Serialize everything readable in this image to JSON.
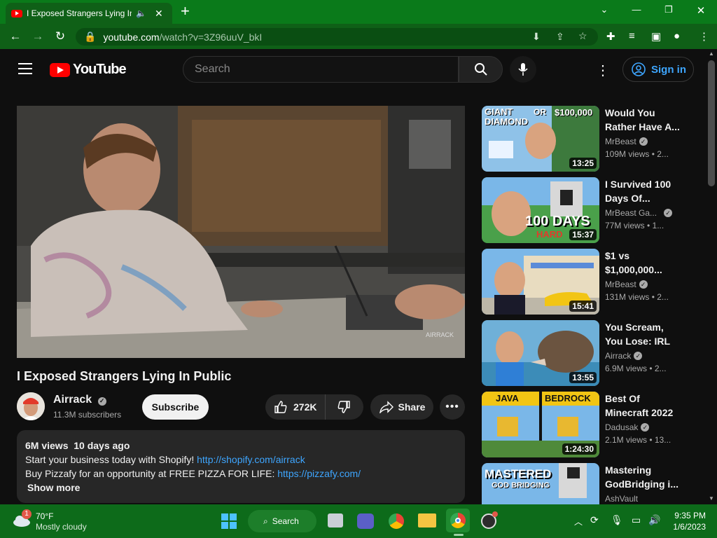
{
  "browser": {
    "tab_title": "I Exposed Strangers Lying In Public",
    "url_host": "youtube.com",
    "url_path": "/watch?v=3Z96uuV_bkI",
    "new_tab": "+"
  },
  "header": {
    "logo_text": "YouTube",
    "search_placeholder": "Search",
    "signin_label": "Sign in"
  },
  "video": {
    "title": "I Exposed Strangers Lying In Public",
    "channel": "Airrack",
    "subscribers": "11.3M subscribers",
    "subscribe_label": "Subscribe",
    "likes": "272K",
    "share_label": "Share",
    "watermark": "AIRRACK"
  },
  "description": {
    "stats": "6M views  10 days ago",
    "line1_text": "Start your business today with Shopify! ",
    "line1_link": "http://shopify.com/airrack",
    "line2_text": "Buy Pizzafy for an opportunity at FREE PIZZA FOR LIFE: ",
    "line2_link": "https://pizzafy.com/",
    "show_more": "Show more"
  },
  "recommendations": [
    {
      "title": "Would You Rather Have A...",
      "channel": "MrBeast",
      "meta": "109M views  • 2...",
      "duration": "13:25",
      "thumb_text": [
        "GIANT DIAMOND",
        "OR",
        "$100,000"
      ]
    },
    {
      "title": "I Survived 100 Days Of...",
      "channel": "MrBeast Ga...",
      "meta": "77M views  • 1...",
      "duration": "15:37",
      "thumb_text": [
        "100 DAYS",
        "HARD"
      ]
    },
    {
      "title": "$1 vs $1,000,000...",
      "channel": "MrBeast",
      "meta": "131M views  • 2...",
      "duration": "15:41",
      "thumb_text": []
    },
    {
      "title": "You Scream, You Lose: IRL",
      "channel": "Airrack",
      "meta": "6.9M views  • 2...",
      "duration": "13:55",
      "thumb_text": []
    },
    {
      "title": "Best Of Minecraft 2022",
      "channel": "Dadusak",
      "meta": "2.1M views  • 13...",
      "duration": "1:24:30",
      "thumb_text": [
        "JAVA",
        "BEDROCK"
      ]
    },
    {
      "title": "Mastering GodBridging i...",
      "channel": "AshVault",
      "meta": "",
      "duration": "",
      "thumb_text": [
        "MASTERED",
        "GOD BRIDGING"
      ]
    }
  ],
  "taskbar": {
    "weather_temp": "70°F",
    "weather_desc": "Mostly cloudy",
    "weather_badge": "1",
    "search_label": "Search",
    "time": "9:35 PM",
    "date": "1/6/2023"
  },
  "colors": {
    "titlebar": "#0a7a1a",
    "yt_red": "#ff0000",
    "link_blue": "#3ea6ff",
    "taskbar": "#0d6b1a"
  }
}
